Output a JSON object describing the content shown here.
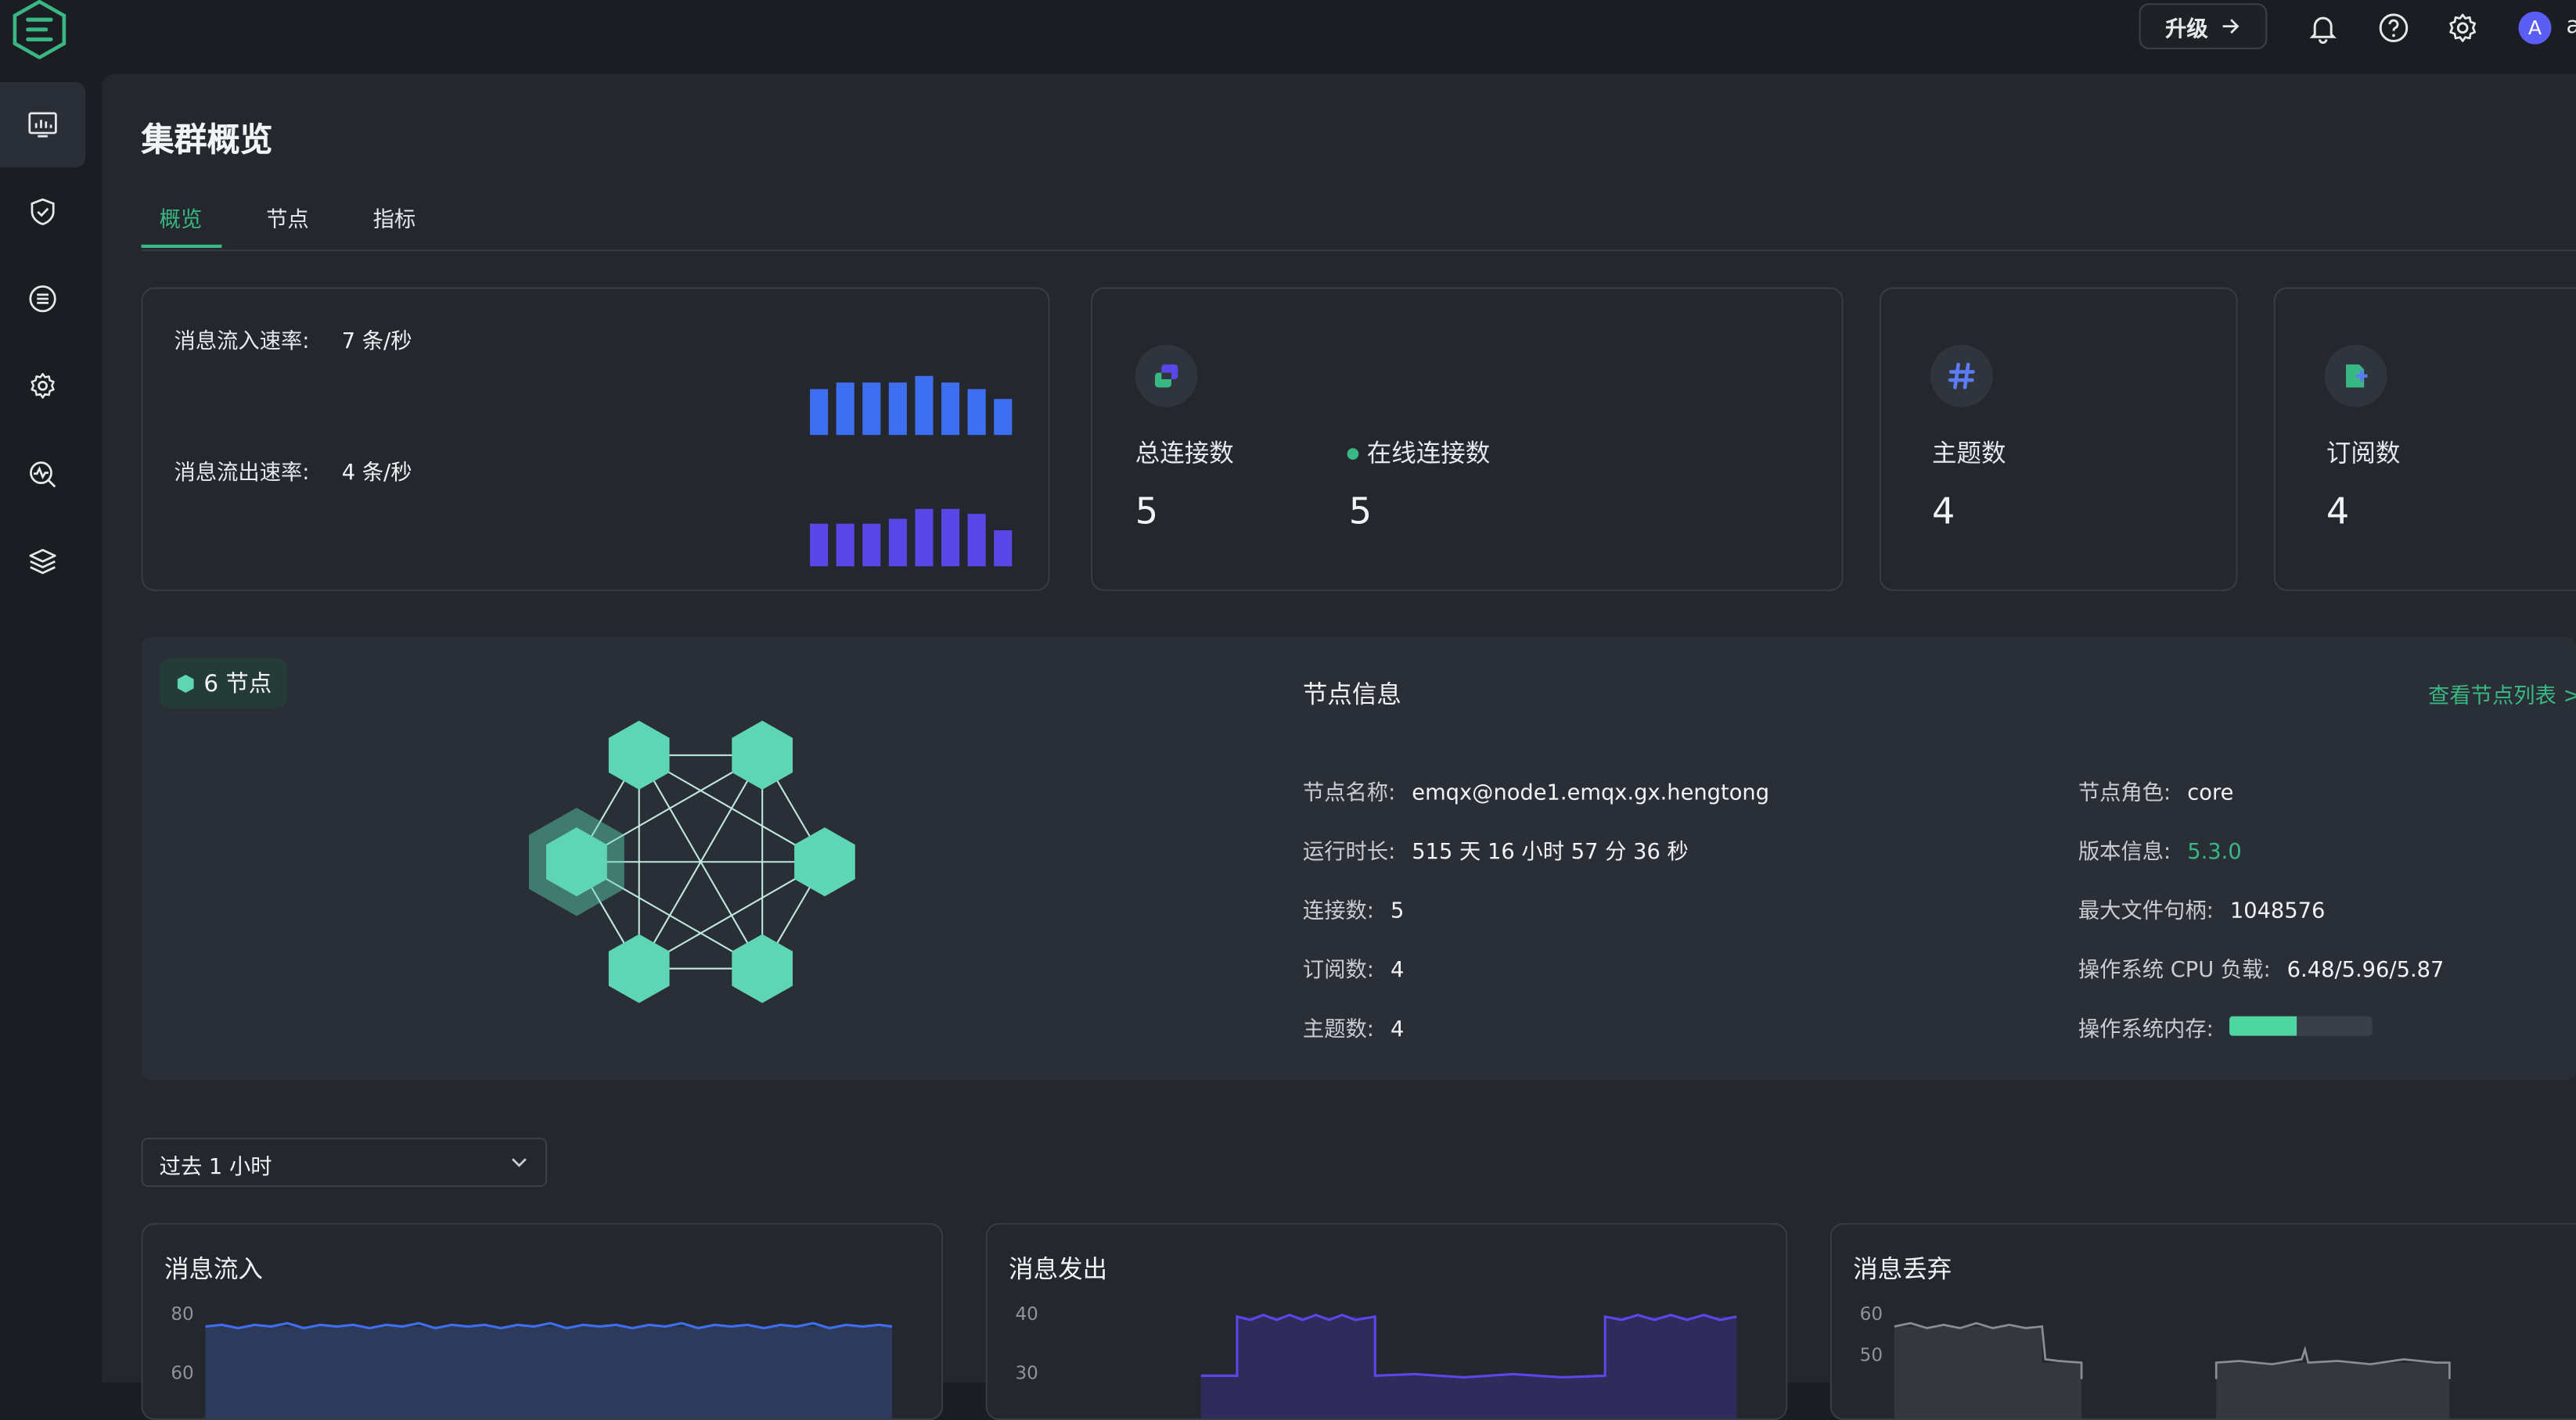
{
  "header": {
    "upgrade_label": "升级",
    "avatar_letter": "A",
    "user_truncated": "a"
  },
  "sidebar": {
    "items": [
      {
        "icon": "dashboard-icon",
        "active": true
      },
      {
        "icon": "shield-icon",
        "active": false
      },
      {
        "icon": "integration-icon",
        "active": false
      },
      {
        "icon": "gear-management-icon",
        "active": false
      },
      {
        "icon": "diagnose-icon",
        "active": false
      },
      {
        "icon": "layers-icon",
        "active": false
      }
    ]
  },
  "page": {
    "title": "集群概览",
    "tabs": [
      {
        "label": "概览",
        "active": true
      },
      {
        "label": "节点",
        "active": false
      },
      {
        "label": "指标",
        "active": false
      }
    ]
  },
  "rates": {
    "in_label": "消息流入速率:",
    "in_value": "7 条/秒",
    "out_label": "消息流出速率:",
    "out_value": "4 条/秒",
    "in_color": "#3e6ff0",
    "out_color": "#5a47e8"
  },
  "stats": {
    "connections_label": "总连接数",
    "connections_value": "5",
    "online_label": "在线连接数",
    "online_value": "5",
    "topics_label": "主题数",
    "topics_value": "4",
    "subscriptions_label": "订阅数",
    "subscriptions_value": "4"
  },
  "cluster": {
    "badge": "6 节点",
    "node_info_title": "节点信息",
    "view_node_list": "查看节点列表 >",
    "node_name_label": "节点名称:",
    "node_name_value": "emqx@node1.emqx.gx.hengtong",
    "uptime_label": "运行时长:",
    "uptime_value": "515 天 16 小时 57 分 36 秒",
    "connections_label": "连接数:",
    "connections_value": "5",
    "subscriptions_label": "订阅数:",
    "subscriptions_value": "4",
    "topics_label": "主题数:",
    "topics_value": "4",
    "role_label": "节点角色:",
    "role_value": "core",
    "version_label": "版本信息:",
    "version_value": "5.3.0",
    "max_fd_label": "最大文件句柄:",
    "max_fd_value": "1048576",
    "cpu_load_label": "操作系统 CPU 负载:",
    "cpu_load_value": "6.48/5.96/5.87",
    "memory_label": "操作系统内存:",
    "memory_usage_fraction": 0.47,
    "hex_color": "#5ed6b3"
  },
  "time_range": {
    "selected": "过去 1 小时"
  },
  "charts": [
    {
      "title": "消息流入",
      "y_ticks": [
        "80",
        "60"
      ],
      "color": "#3e6ff0"
    },
    {
      "title": "消息发出",
      "y_ticks": [
        "40",
        "30"
      ],
      "color": "#5a47e8"
    },
    {
      "title": "消息丢弃",
      "y_ticks": [
        "60",
        "50"
      ],
      "color": "#8a8d93"
    }
  ]
}
